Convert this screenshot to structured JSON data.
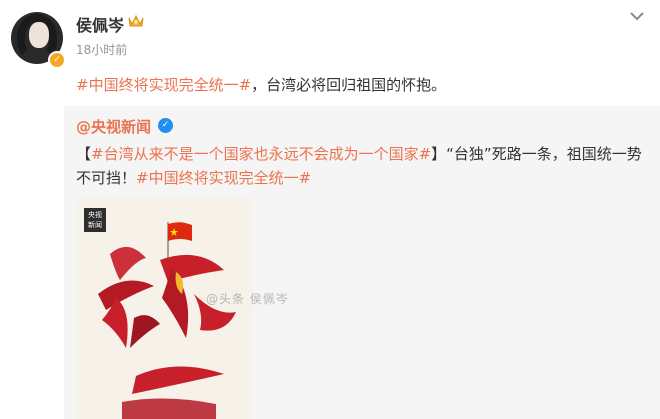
{
  "post": {
    "author_name": "侯佩岑",
    "time": "18小时前",
    "text_hashtag": "#中国终将实现完全统一#",
    "text_body": "，台湾必将回归祖国的怀抱。"
  },
  "repost": {
    "author": "@央视新闻",
    "text_open": "【",
    "hashtag1": "#台湾从来不是一个国家也永远不会成为一个国家#",
    "text_mid": "】“台独”死路一条，祖国统一势不可挡！",
    "hashtag2": "#中国终将实现完全统一#",
    "card": {
      "logo_line1": "央视",
      "logo_line2": "新闻",
      "colors": {
        "background": "#f6f2ea",
        "brush": "#c8202a",
        "flag": "#de2910",
        "flag_star": "#ffde00",
        "island": "#f1b82d"
      }
    }
  },
  "watermark": "@头条 侯佩岑",
  "icons": {
    "crown": "crown-icon",
    "chevron": "chevron-down-icon",
    "verified": "verified-icon"
  },
  "colors": {
    "hashtag": "#eb7350",
    "text": "#333333",
    "muted": "#939393",
    "repost_bg": "#f5f5f5"
  }
}
